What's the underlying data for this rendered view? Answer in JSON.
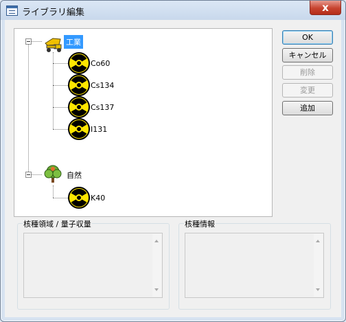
{
  "window": {
    "title": "ライブラリ編集",
    "close_label": "x"
  },
  "tree": {
    "root": {
      "label": "工業",
      "children": [
        "Co60",
        "Cs134",
        "Cs137",
        "I131"
      ]
    },
    "nature": {
      "label": "自然",
      "children": [
        "K40"
      ]
    }
  },
  "buttons": {
    "ok": "OK",
    "cancel": "キャンセル",
    "delete": "削除",
    "change": "変更",
    "add": "追加"
  },
  "groups": {
    "left_title": "核種領域 / 量子収量",
    "right_title": "核種情報"
  }
}
